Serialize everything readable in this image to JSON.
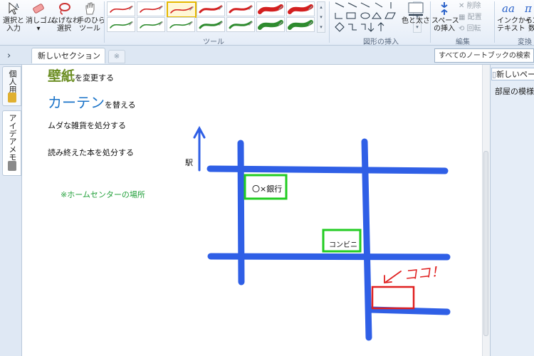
{
  "ribbon": {
    "buttons": {
      "select_input": "選択と\n入力",
      "eraser": "消しゴム\n▾",
      "lasso": "なげなわ\n選択",
      "pan": "手のひら\nツール",
      "color_thickness": "色と太さ",
      "insert_space": "スペース\nの挿入",
      "delete": "削除",
      "arrange": "配置",
      "rotate": "回転",
      "ink_to_text": "インクから\nテキスト",
      "ink_to_math": "イン\n数"
    },
    "groups": {
      "tools": "ツール",
      "insert_shapes": "図形の挿入",
      "edit": "編集",
      "convert": "変換"
    },
    "pens": [
      {
        "color": "#d32020",
        "style": "thin"
      },
      {
        "color": "#d32020",
        "style": "thin"
      },
      {
        "color": "#d32020",
        "style": "thin",
        "selected": true
      },
      {
        "color": "#d32020",
        "style": "medium"
      },
      {
        "color": "#d32020",
        "style": "medium"
      },
      {
        "color": "#d32020",
        "style": "thick"
      },
      {
        "color": "#d32020",
        "style": "thick"
      },
      {
        "color": "#2e8b2e",
        "style": "thin"
      },
      {
        "color": "#2e8b2e",
        "style": "thin"
      },
      {
        "color": "#2e8b2e",
        "style": "thin"
      },
      {
        "color": "#2e8b2e",
        "style": "medium"
      },
      {
        "color": "#2e8b2e",
        "style": "medium"
      },
      {
        "color": "#2e8b2e",
        "style": "thick"
      },
      {
        "color": "#2e8b2e",
        "style": "thick"
      }
    ]
  },
  "tabs": {
    "collapse_arrow": "›",
    "section_tab": "新しいセクション 1",
    "new_tab": "※"
  },
  "search": {
    "placeholder": "すべてのノートブックの検索 (Ct"
  },
  "sidebar": {
    "notebooks": [
      {
        "label": "個人用",
        "color": "#e0b030"
      },
      {
        "label": "アイデアメモ",
        "color": "#7a7a7a"
      }
    ]
  },
  "pagelist": {
    "selected": "新しいペー",
    "item": "部屋の模様替"
  },
  "note": {
    "line1_big": "壁紙",
    "line1_rest": "を変更する",
    "line2_big": "カーテン",
    "line2_rest": "を替える",
    "line3": "ムダな雑貨を処分する",
    "line4": "読み終えた本を処分する",
    "line5": "※ホームセンターの場所",
    "colors": {
      "line1": "#6b8e23",
      "line2": "#1a73c8",
      "line5": "#22a03a"
    }
  },
  "map": {
    "station": "駅",
    "bank": "〇×銀行",
    "convenience": "コンビニ",
    "here": "ココ！",
    "road_color": "#2f5fe6",
    "box_color": "#22cc22",
    "ink_color": "#e02020"
  }
}
